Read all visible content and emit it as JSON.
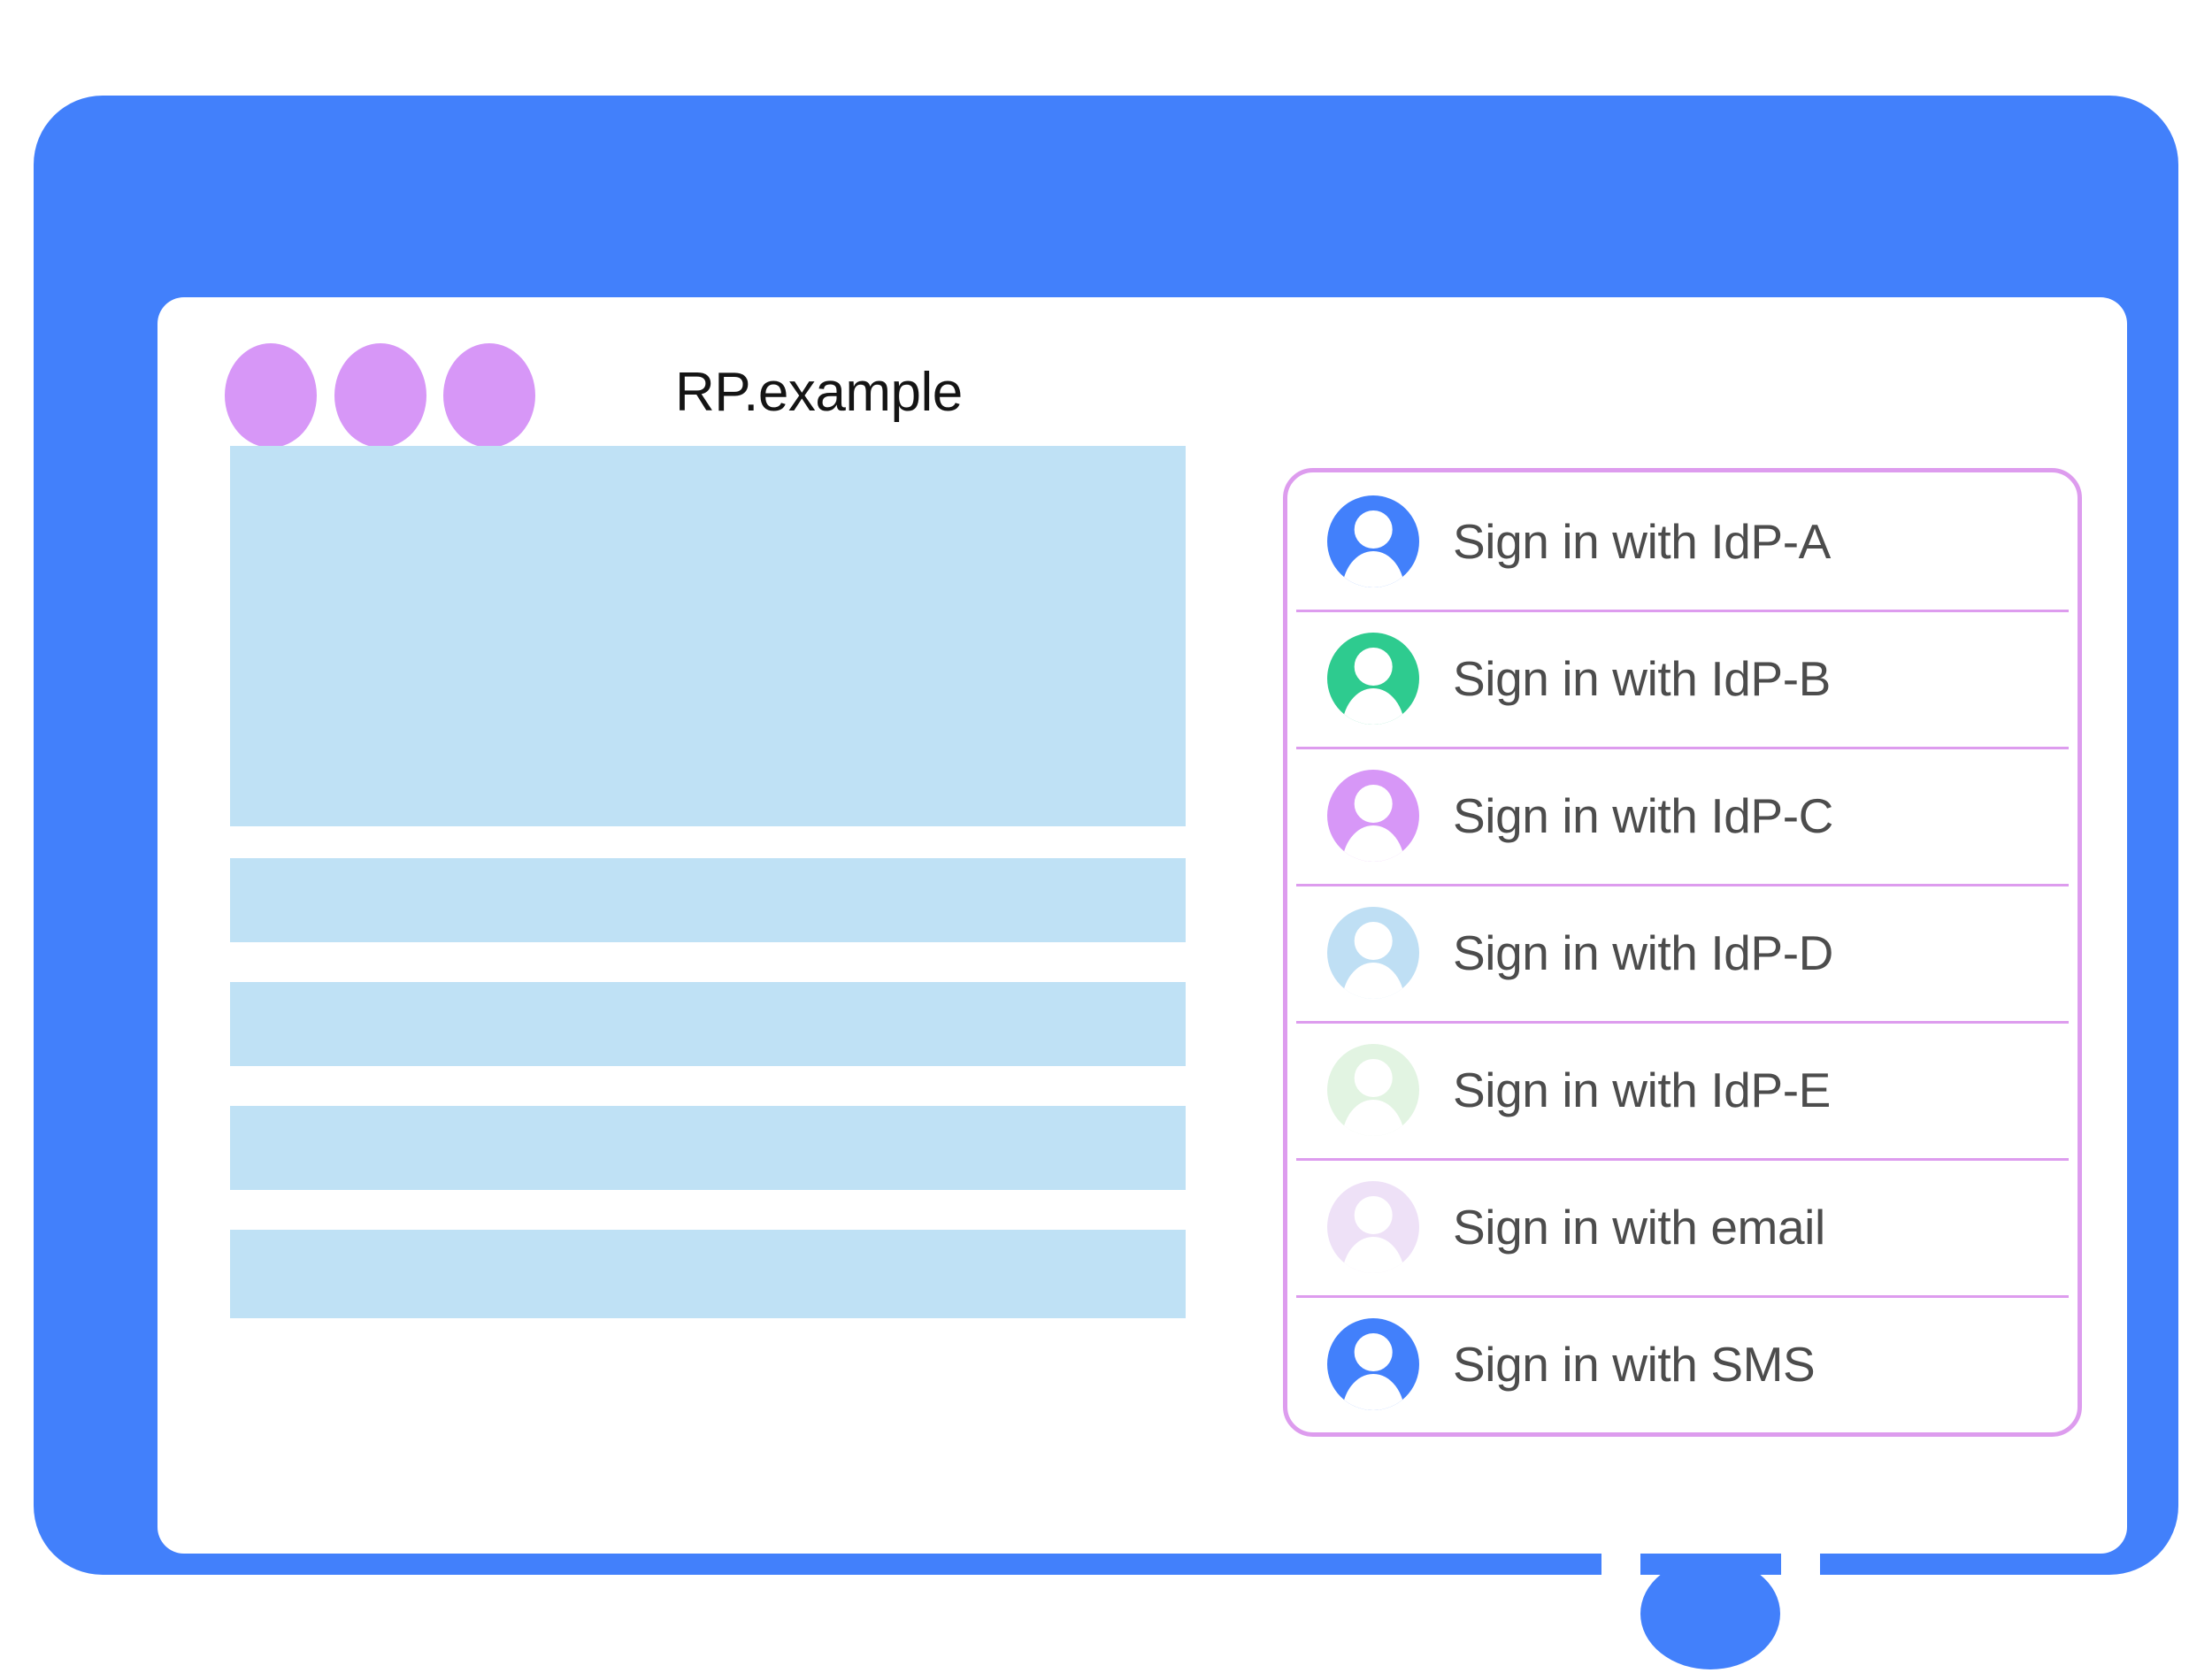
{
  "app": {
    "title": "RP.example",
    "window_dots": [
      {
        "name": "window-dot-1",
        "color": "#d797f7"
      },
      {
        "name": "window-dot-2",
        "color": "#d797f7"
      },
      {
        "name": "window-dot-3",
        "color": "#d797f7"
      }
    ]
  },
  "colors": {
    "device_frame": "#4280fb",
    "screen": "#ffffff",
    "placeholder": "#bfe1f5",
    "panel_border": "#dd9cee",
    "divider": "#dd9cee",
    "label_text": "#4c4c4c",
    "title_text": "#141414",
    "window_dot": "#d797f7"
  },
  "content": {
    "placeholders": [
      {
        "name": "content-hero-placeholder",
        "shape": "hero"
      },
      {
        "name": "content-line-placeholder-1",
        "shape": "line"
      },
      {
        "name": "content-line-placeholder-2",
        "shape": "line"
      },
      {
        "name": "content-line-placeholder-3",
        "shape": "line"
      },
      {
        "name": "content-line-placeholder-4",
        "shape": "line"
      }
    ]
  },
  "account_chooser": {
    "rows": [
      {
        "label": "Sign in with IdP-A",
        "avatar_icon": "person-avatar-icon",
        "avatar_color": "#4280fb"
      },
      {
        "label": "Sign in with IdP-B",
        "avatar_icon": "person-avatar-icon",
        "avatar_color": "#2ecb8f"
      },
      {
        "label": "Sign in with IdP-C",
        "avatar_icon": "person-avatar-icon",
        "avatar_color": "#d797f7"
      },
      {
        "label": "Sign in with IdP-D",
        "avatar_icon": "person-avatar-icon",
        "avatar_color": "#bfdff4"
      },
      {
        "label": "Sign in with IdP-E",
        "avatar_icon": "person-avatar-icon",
        "avatar_color": "#e2f4e2"
      },
      {
        "label": "Sign in with email",
        "avatar_icon": "person-avatar-icon",
        "avatar_color": "#eee1f7"
      },
      {
        "label": "Sign in with SMS",
        "avatar_icon": "person-avatar-icon",
        "avatar_color": "#4280fb"
      }
    ]
  },
  "device": {
    "home_button": "home-button"
  }
}
